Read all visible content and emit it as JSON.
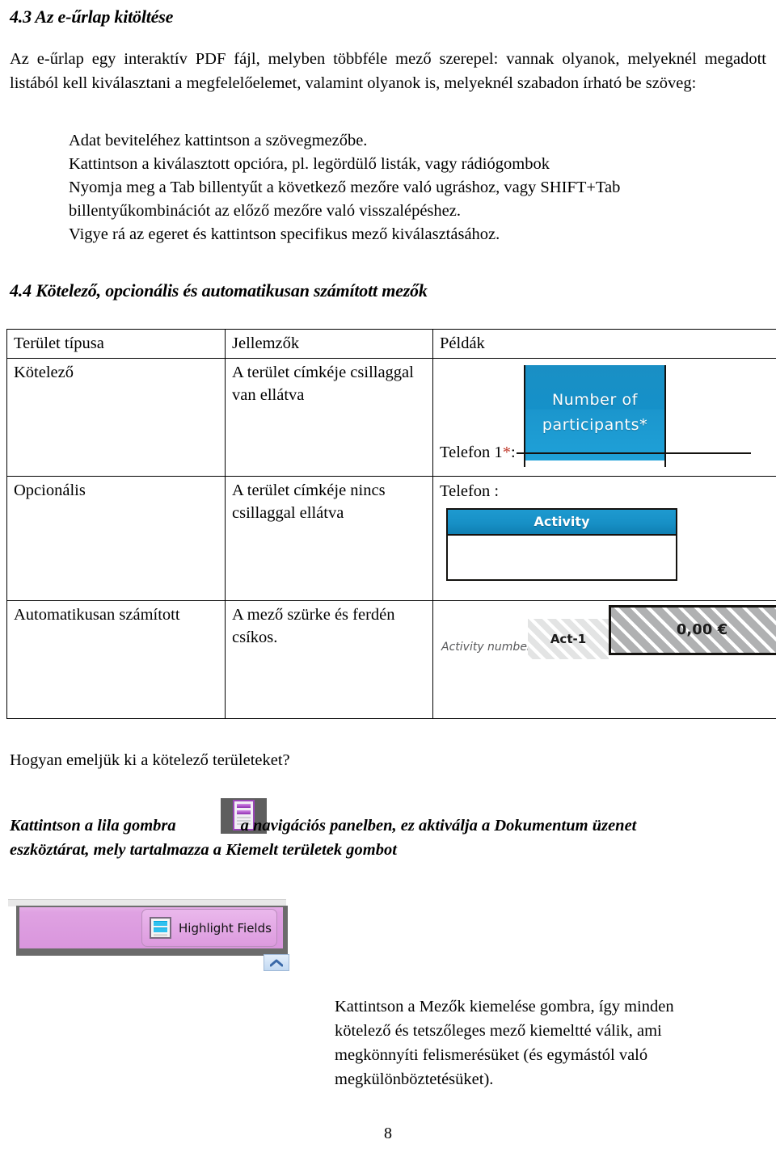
{
  "document": {
    "page_number": "8",
    "section_43": {
      "heading": "4.3 Az e-űrlap kitöltése",
      "intro": "Az e-űrlap egy interaktív PDF fájl, melyben többféle mező szerepel: vannak olyanok, melyeknél megadott listából kell kiválasztani a megfelelőelemet, valamint olyanok is, melyeknél szabadon írható be szöveg:",
      "bullets": [
        "Adat beviteléhez kattintson a szövegmezőbe.",
        "Kattintson a kiválasztott opcióra, pl. legördülő listák, vagy rádiógombok",
        "Nyomja meg a Tab billentyűt a következő mezőre való ugráshoz, vagy SHIFT+Tab billentyűkombinációt az előző mezőre való visszalépéshez.",
        "Vigye rá az egeret és kattintson specifikus mező kiválasztásához."
      ]
    },
    "section_44": {
      "heading": "4.4 Kötelező, opcionális és automatikusan számított mezők",
      "table": {
        "headers": [
          "Terület típusa",
          "Jellemzők",
          "Példák"
        ],
        "rows": [
          {
            "type": "Kötelező",
            "characteristics": "A terület címkéje csillaggal van ellátva",
            "example": {
              "kind": "required-field",
              "blue_box_line1": "Number of",
              "blue_box_line2": "participants*",
              "label_text": "Telefon 1",
              "label_star": "*",
              "label_colon": ":"
            }
          },
          {
            "type": "Opcionális",
            "characteristics": "A terület címkéje nincs csillaggal ellátva",
            "example": {
              "kind": "optional-field",
              "label_text": "Telefon :",
              "widget_header": "Activity"
            }
          },
          {
            "type": "Automatikusan számított",
            "characteristics": "A mező szürke és ferdén csíkos.",
            "example": {
              "kind": "calculated-field",
              "label": "Activity number",
              "value_small": "Act-1",
              "value_large": "0,00 €"
            }
          }
        ]
      }
    },
    "highlight_section": {
      "question": "Hogyan emeljük ki a kötelező területeket?",
      "instruction_part1": "Kattintson a lila gombra",
      "instruction_part2": "a navigációs panelben, ez aktiválja a Dokumentum üzenet",
      "instruction_line2": "eszköztárat, mely tartalmazza a Kiemelt területek gombot",
      "toolbar_button_label": "Highlight Fields",
      "closing": "Kattintson a Mezők kiemelése gombra, így minden kötelező és tetszőleges mező kiemeltté válik, ami megkönnyíti felismerésüket (és egymástól való megkülönböztetésüket)."
    }
  },
  "colors": {
    "blue_field": "#1a8fc4",
    "activity_header": "#1790c6",
    "required_star": "#c0392b",
    "hatch_light": "#e9eaea",
    "hatch_dark": "#b7b8b9",
    "toolbar_purple": "#dfa2e2",
    "toolbar_frame": "#6b6b6b",
    "nav_icon_bg": "#5e5e5e",
    "nav_icon_purple": "#9b45b8",
    "highlight_icon_blue": "#2fc1ef"
  }
}
